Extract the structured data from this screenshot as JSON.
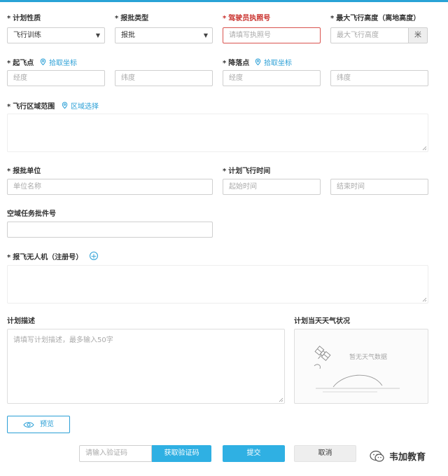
{
  "form": {
    "plan_nature": {
      "label": "计划性质",
      "value": "飞行训练"
    },
    "approval_type": {
      "label": "报批类型",
      "value": "报批"
    },
    "pilot_license": {
      "label": "驾驶员执照号",
      "placeholder": "请填写执照号"
    },
    "max_altitude": {
      "label": "最大飞行高度（离地高度）",
      "placeholder": "最大飞行高度",
      "unit": "米"
    },
    "takeoff": {
      "label": "起飞点",
      "pick_label": "拾取坐标",
      "lon_placeholder": "经度",
      "lat_placeholder": "纬度"
    },
    "landing": {
      "label": "降落点",
      "pick_label": "拾取坐标",
      "lon_placeholder": "经度",
      "lat_placeholder": "纬度"
    },
    "flight_area": {
      "label": "飞行区域范围",
      "pick_label": "区域选择"
    },
    "approval_unit": {
      "label": "报批单位",
      "placeholder": "单位名称"
    },
    "flight_time": {
      "label": "计划飞行时间",
      "start_placeholder": "起始时间",
      "end_placeholder": "结束时间"
    },
    "airspace_number": {
      "label": "空域任务批件号"
    },
    "drones": {
      "label": "报飞无人机（注册号）"
    },
    "description": {
      "label": "计划描述",
      "placeholder": "请填写计划描述，最多输入50字"
    },
    "weather": {
      "label": "计划当天天气状况",
      "image_text": "暂无天气数据"
    }
  },
  "buttons": {
    "preview": "预览",
    "captcha_placeholder": "请输入验证码",
    "get_captcha": "获取验证码",
    "submit": "提交",
    "cancel": "取消"
  },
  "required_marker": "*",
  "watermark": "韦加教育",
  "colors": {
    "accent": "#2fb0e3",
    "error": "#c9302c",
    "link": "#2a9fd6"
  }
}
